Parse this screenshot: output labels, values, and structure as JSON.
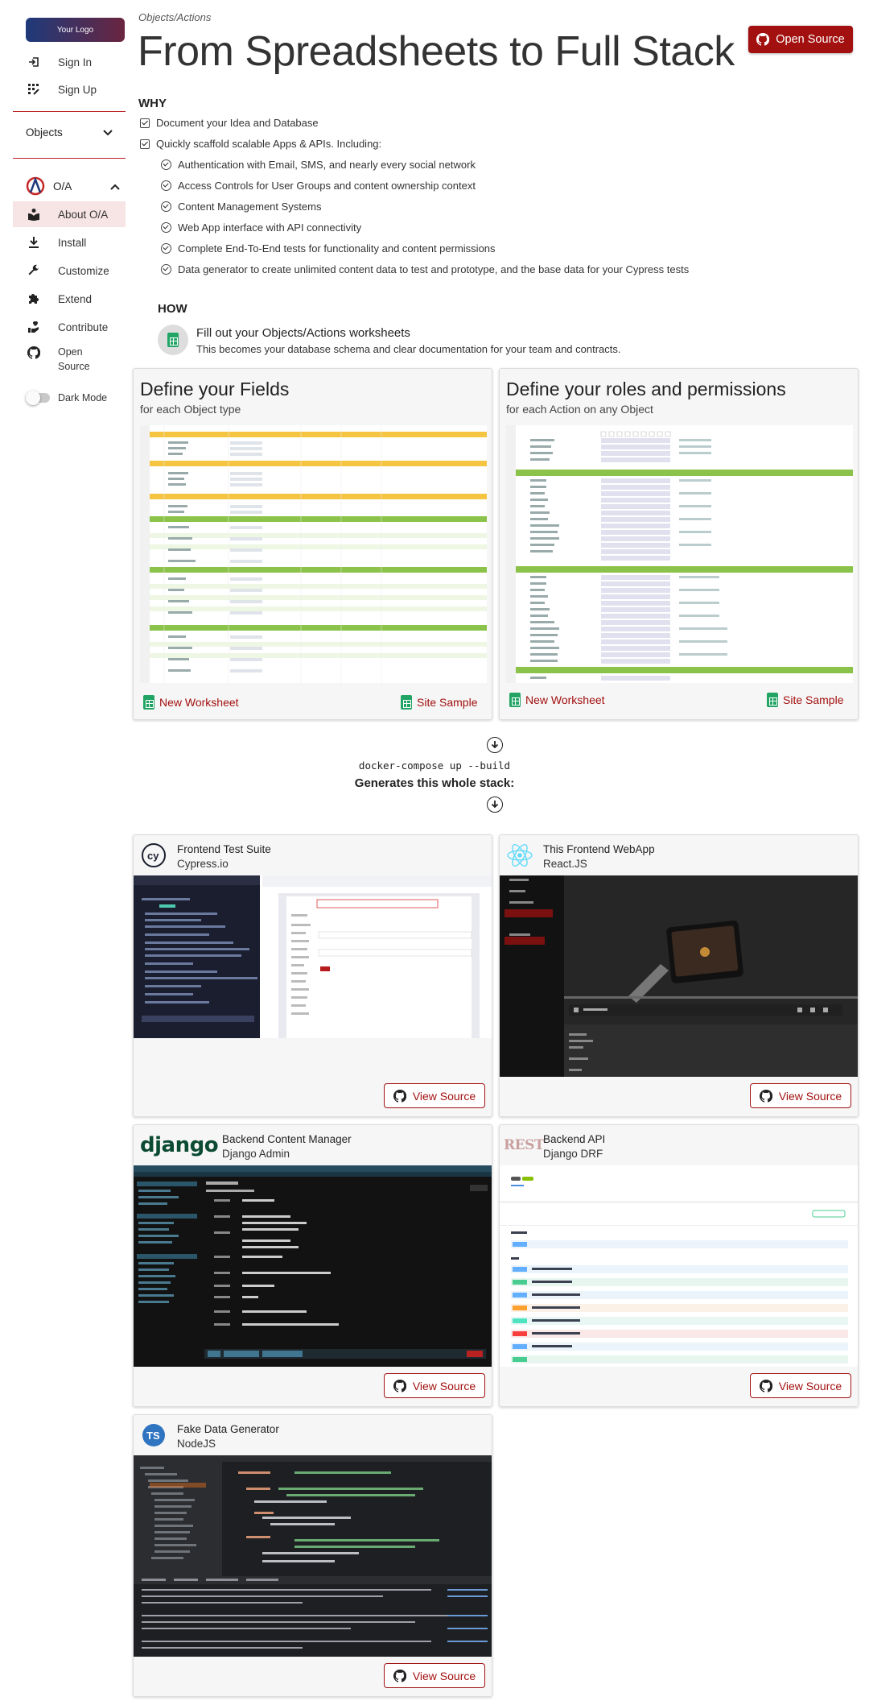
{
  "sidebar": {
    "logo": "Your Logo",
    "sign_in": "Sign In",
    "sign_up": "Sign Up",
    "objects": "Objects",
    "oa": "O/A",
    "items": [
      {
        "label": "About O/A",
        "icon": "book-reader-icon"
      },
      {
        "label": "Install",
        "icon": "download-icon"
      },
      {
        "label": "Customize",
        "icon": "wrench-icon"
      },
      {
        "label": "Extend",
        "icon": "puzzle-icon"
      },
      {
        "label": "Contribute",
        "icon": "hand-heart-icon"
      },
      {
        "label": "Open Source",
        "icon": "github-icon"
      }
    ],
    "dark_mode": "Dark Mode"
  },
  "header": {
    "breadcrumb": "Objects/Actions",
    "title": "From Spreadsheets to Full Stack",
    "open_source": "Open Source"
  },
  "why": {
    "heading": "WHY",
    "items": [
      "Document your Idea and Database",
      "Quickly scaffold scalable Apps & APIs. Including:"
    ],
    "sub_items": [
      "Authentication with Email, SMS, and nearly every social network",
      "Access Controls for User Groups and content ownership context",
      "Content Management Systems",
      "Web App interface with API connectivity",
      "Complete End-To-End tests for functionality and content permissions",
      "Data generator to create unlimited content data to test and prototype, and the base data for your Cypress tests"
    ]
  },
  "how": {
    "heading": "HOW",
    "title": "Fill out your Objects/Actions worksheets",
    "subtitle": "This becomes your database schema and clear documentation for your team and contracts."
  },
  "worksheets": [
    {
      "title": "Define your Fields",
      "subtitle": "for each Object type",
      "new_label": "New Worksheet",
      "sample_label": "Site Sample"
    },
    {
      "title": "Define your roles and permissions",
      "subtitle": "for each Action on any Object",
      "new_label": "New Worksheet",
      "sample_label": "Site Sample"
    }
  ],
  "build": {
    "command": "docker-compose up --build",
    "title": "Generates this whole stack:"
  },
  "stack": [
    {
      "name": "Frontend Test Suite",
      "tech": "Cypress.io",
      "button": "View Source",
      "logo": "cy"
    },
    {
      "name": "This Frontend WebApp",
      "tech": "React.JS",
      "button": "View Source",
      "logo": "react-icon"
    },
    {
      "name": "Backend Content Manager",
      "tech": "Django Admin",
      "button": "View Source",
      "logo": "django"
    },
    {
      "name": "Backend API",
      "tech": "Django DRF",
      "button": "View Source",
      "logo": "REST"
    },
    {
      "name": "Fake Data Generator",
      "tech": "NodeJS",
      "button": "View Source",
      "logo": "TS"
    }
  ],
  "colors": {
    "brand_red": "#a31010",
    "sheet_yellow": "#f5c542",
    "sheet_green": "#8bc34a"
  }
}
